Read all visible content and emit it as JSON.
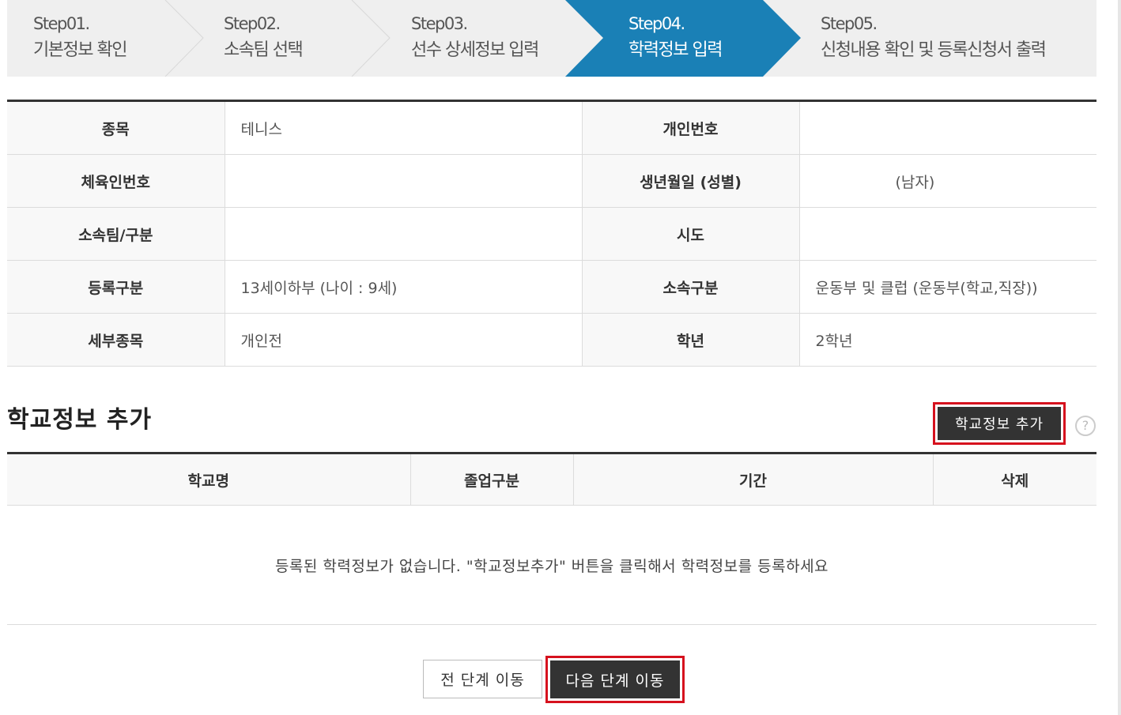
{
  "steps": [
    {
      "num": "Step01.",
      "label": "기본정보 확인"
    },
    {
      "num": "Step02.",
      "label": "소속팀 선택"
    },
    {
      "num": "Step03.",
      "label": "선수 상세정보 입력"
    },
    {
      "num": "Step04.",
      "label": "학력정보 입력"
    },
    {
      "num": "Step05.",
      "label": "신청내용 확인 및 등록신청서 출력"
    }
  ],
  "active_step": 4,
  "colors": {
    "active_step": "#1a80b6",
    "inactive_step": "#efefef",
    "highlight": "#d6111e",
    "dark_button": "#333333"
  },
  "info": [
    {
      "l1": "종목",
      "v1": "테니스",
      "l2": "개인번호",
      "v2": ""
    },
    {
      "l1": "체육인번호",
      "v1": "",
      "l2": "생년월일 (성별)",
      "v2": "(남자)"
    },
    {
      "l1": "소속팀/구분",
      "v1": "",
      "l2": "시도",
      "v2": ""
    },
    {
      "l1": "등록구분",
      "v1": "13세이하부 (나이 : 9세)",
      "l2": "소속구분",
      "v2": "운동부 및 클럽 (운동부(학교,직장))"
    },
    {
      "l1": "세부종목",
      "v1": "개인전",
      "l2": "학년",
      "v2": "2학년"
    }
  ],
  "section": {
    "title": "학교정보 추가",
    "add_button": "학교정보 추가",
    "help": "?"
  },
  "school_table": {
    "headers": [
      "학교명",
      "졸업구분",
      "기간",
      "삭제"
    ],
    "empty_message": "등록된 학력정보가 없습니다. \"학교정보추가\" 버튼을 클릭해서 학력정보를 등록하세요"
  },
  "buttons": {
    "prev": "전 단계 이동",
    "next": "다음 단계 이동"
  }
}
